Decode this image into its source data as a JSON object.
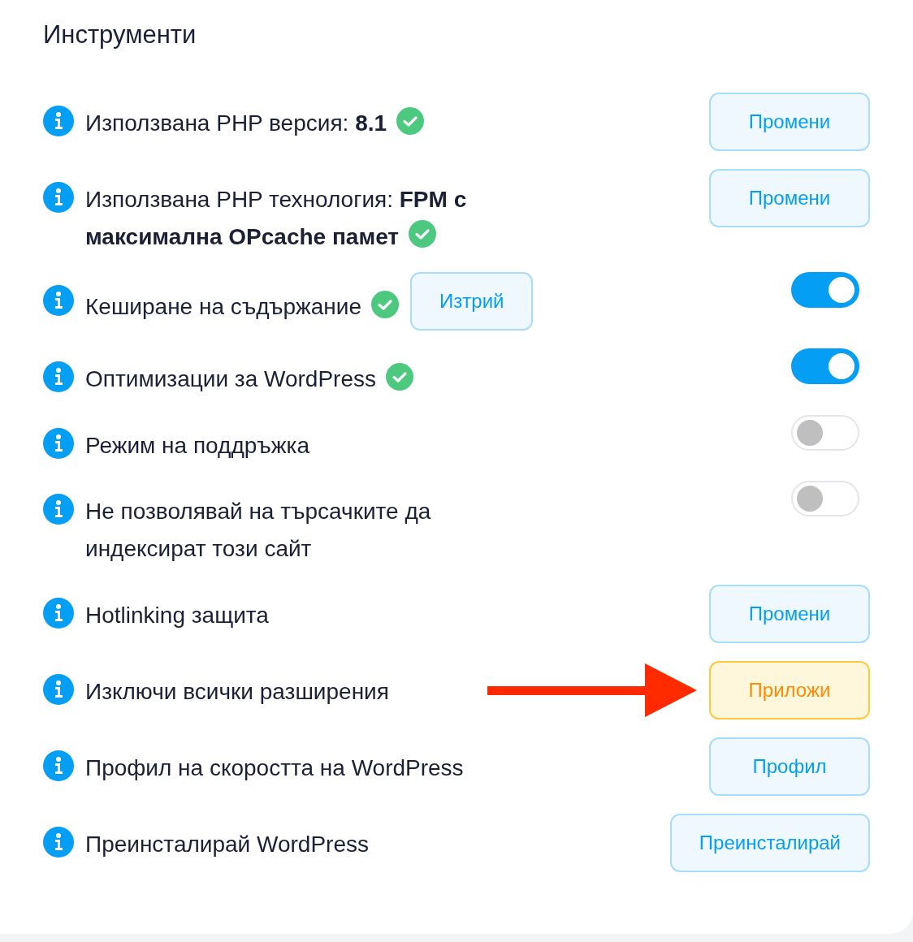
{
  "title": "Инструменти",
  "rows": [
    {
      "label": "Използвана PHP версия: **8.1**",
      "verified": true,
      "kind": "button",
      "button": {
        "label": "Промени",
        "highlighted": false
      }
    },
    {
      "label": "Използвана PHP технология: **FPM с максимална OPcache памет**",
      "verified": true,
      "kind": "button",
      "button": {
        "label": "Промени",
        "highlighted": false
      }
    },
    {
      "label": "Кеширане на съдържание",
      "verified": true,
      "kind": "toggle",
      "on": true,
      "inline_button": {
        "label": "Изтрий",
        "highlighted": false
      }
    },
    {
      "label": "Оптимизации за WordPress",
      "verified": true,
      "kind": "toggle",
      "on": true
    },
    {
      "label": "Режим на поддръжка",
      "verified": false,
      "kind": "toggle",
      "on": false
    },
    {
      "label": "Не позволявай на търсачките да индексират този сайт",
      "verified": false,
      "kind": "toggle",
      "on": false
    },
    {
      "label": "Hotlinking защита",
      "verified": false,
      "kind": "button",
      "button": {
        "label": "Промени",
        "highlighted": false
      }
    },
    {
      "label": "Изключи всички разширения",
      "verified": false,
      "kind": "button",
      "button": {
        "label": "Приложи",
        "highlighted": true
      }
    },
    {
      "label": "Профил на скоростта на WordPress",
      "verified": false,
      "kind": "button",
      "button": {
        "label": "Профил",
        "highlighted": false
      }
    },
    {
      "label": "Преинсталирай WordPress",
      "verified": false,
      "kind": "button",
      "button": {
        "label": "Преинсталирай",
        "highlighted": false
      }
    }
  ]
}
